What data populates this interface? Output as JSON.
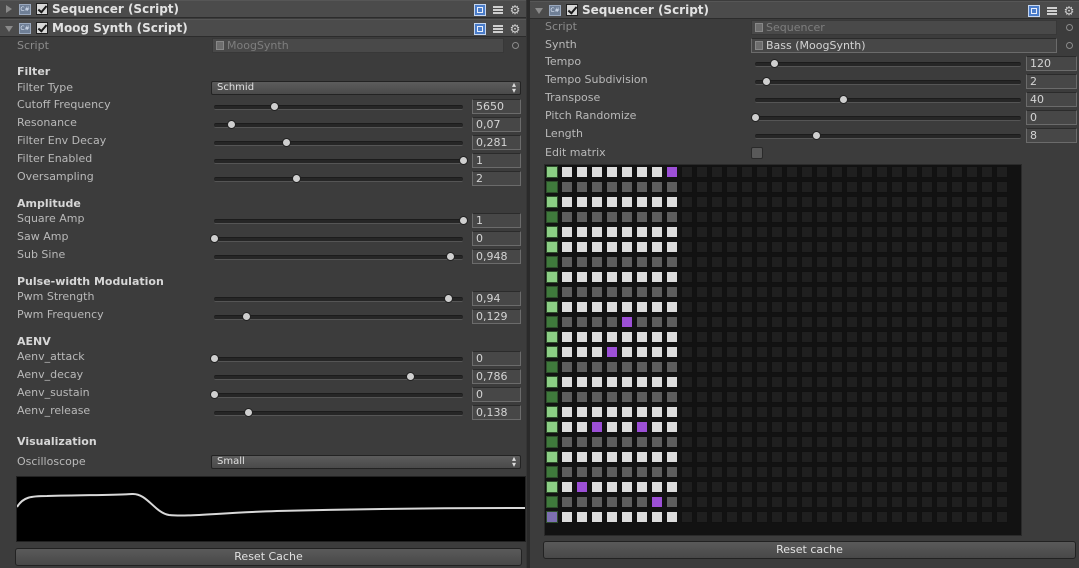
{
  "left": {
    "collapsed_component": {
      "title": "Sequencer (Script)",
      "icon": "script-icon"
    },
    "component": {
      "title": "Moog Synth (Script)",
      "icon": "script-icon"
    },
    "script_row": {
      "label": "Script",
      "value": "MoogSynth"
    },
    "sections": {
      "filter": "Filter",
      "amplitude": "Amplitude",
      "pwm": "Pulse-width Modulation",
      "aenv": "AENV",
      "visualization": "Visualization"
    },
    "filter_type": {
      "label": "Filter Type",
      "value": "Schmid"
    },
    "sliders": [
      {
        "label": "Cutoff Frequency",
        "value": "5650",
        "pos": 0.24
      },
      {
        "label": "Resonance",
        "value": "0,07",
        "pos": 0.07
      },
      {
        "label": "Filter Env Decay",
        "value": "0,281",
        "pos": 0.29
      },
      {
        "label": "Filter Enabled",
        "value": "1",
        "pos": 1.0
      },
      {
        "label": "Oversampling",
        "value": "2",
        "pos": 0.33
      },
      {
        "label": "Square Amp",
        "value": "1",
        "pos": 1.0
      },
      {
        "label": "Saw Amp",
        "value": "0",
        "pos": 0.0
      },
      {
        "label": "Sub Sine",
        "value": "0,948",
        "pos": 0.948
      },
      {
        "label": "Pwm Strength",
        "value": "0,94",
        "pos": 0.94
      },
      {
        "label": "Pwm Frequency",
        "value": "0,129",
        "pos": 0.129
      },
      {
        "label": "Aenv_attack",
        "value": "0",
        "pos": 0.0
      },
      {
        "label": "Aenv_decay",
        "value": "0,786",
        "pos": 0.786
      },
      {
        "label": "Aenv_sustain",
        "value": "0",
        "pos": 0.0
      },
      {
        "label": "Aenv_release",
        "value": "0,138",
        "pos": 0.138
      }
    ],
    "oscilloscope": {
      "label": "Oscilloscope",
      "value": "Small"
    },
    "reset_button": "Reset Cache"
  },
  "right": {
    "component": {
      "title": "Sequencer (Script)",
      "icon": "script-icon"
    },
    "script_row": {
      "label": "Script",
      "value": "Sequencer"
    },
    "synth_row": {
      "label": "Synth",
      "value": "Bass (MoogSynth)"
    },
    "sliders": [
      {
        "label": "Tempo",
        "value": "120",
        "pos": 0.07
      },
      {
        "label": "Tempo Subdivision",
        "value": "2",
        "pos": 0.04
      },
      {
        "label": "Transpose",
        "value": "40",
        "pos": 0.33
      },
      {
        "label": "Pitch Randomize",
        "value": "0",
        "pos": 0.0
      },
      {
        "label": "Length",
        "value": "8",
        "pos": 0.23
      }
    ],
    "edit_matrix": {
      "label": "Edit matrix",
      "checked": false
    },
    "matrix": {
      "columns": 31,
      "rows": 24,
      "active_columns": 8,
      "notes": [
        [
          0,
          7
        ],
        [
          10,
          4
        ],
        [
          12,
          3
        ],
        [
          17,
          2
        ],
        [
          17,
          5
        ],
        [
          21,
          1
        ],
        [
          22,
          6
        ]
      ],
      "colors": {
        "active_white": "#dcdcdc",
        "active_grey": "#5e5e5e",
        "note": "#9c4fd6",
        "inactive": "#1f1f1f",
        "key_white": "#8ccf85",
        "key_black": "#3f7a3c"
      }
    },
    "reset_button": "Reset cache"
  },
  "header_icons": [
    "book-icon",
    "preset-icon",
    "gear-icon"
  ]
}
